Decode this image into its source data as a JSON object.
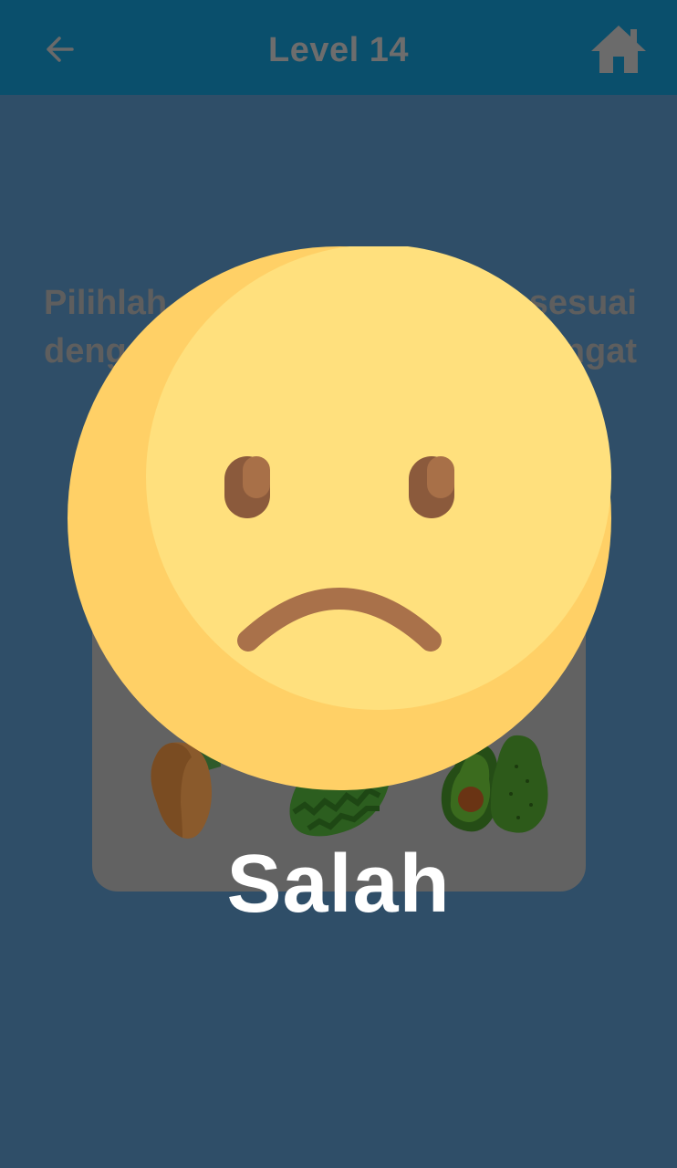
{
  "header": {
    "title": "Level 14",
    "back_icon": "arrow-left-icon",
    "home_icon": "home-icon"
  },
  "question": {
    "line1_left": "Pilihlah",
    "line1_right": "sesuai",
    "line2_left": "deng",
    "line2_right": "ngat"
  },
  "options": [
    {
      "icon": "mango-icon"
    },
    {
      "icon": "watermelon-icon"
    },
    {
      "icon": "avocado-icon"
    }
  ],
  "feedback": {
    "icon": "sad-face-icon",
    "label": "Salah"
  },
  "colors": {
    "background": "#2f4e68",
    "topbar": "#0a4f6c",
    "card": "#626262",
    "face": "#ffe07d",
    "face_shadow": "#ffd066",
    "result_text": "#ffffff"
  }
}
